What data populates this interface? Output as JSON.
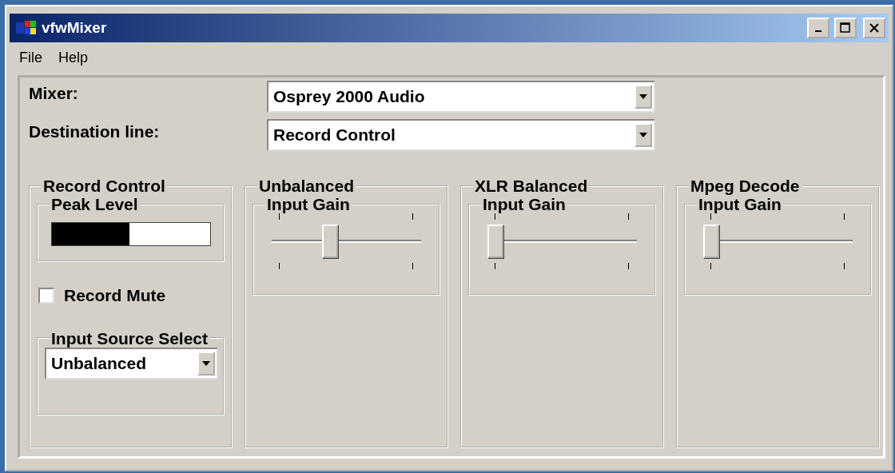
{
  "window": {
    "title": "vfwMixer"
  },
  "menu": [
    {
      "label": "File"
    },
    {
      "label": "Help"
    }
  ],
  "mixer": {
    "label": "Mixer:",
    "value": "Osprey 2000 Audio"
  },
  "destination": {
    "label": "Destination line:",
    "value": "Record Control"
  },
  "record_control": {
    "title": "Record Control",
    "peak": {
      "title": "Peak Level",
      "level": 0.49
    },
    "mute": {
      "label": "Record Mute",
      "checked": false
    },
    "source": {
      "title": "Input Source Select",
      "value": "Unbalanced"
    }
  },
  "channels": [
    {
      "title": "Unbalanced",
      "gain_title": "Input Gain",
      "level": 0.38
    },
    {
      "title": "XLR Balanced",
      "gain_title": "Input Gain",
      "level": 0
    },
    {
      "title": "Mpeg Decode",
      "gain_title": "Input Gain",
      "level": 0
    }
  ]
}
